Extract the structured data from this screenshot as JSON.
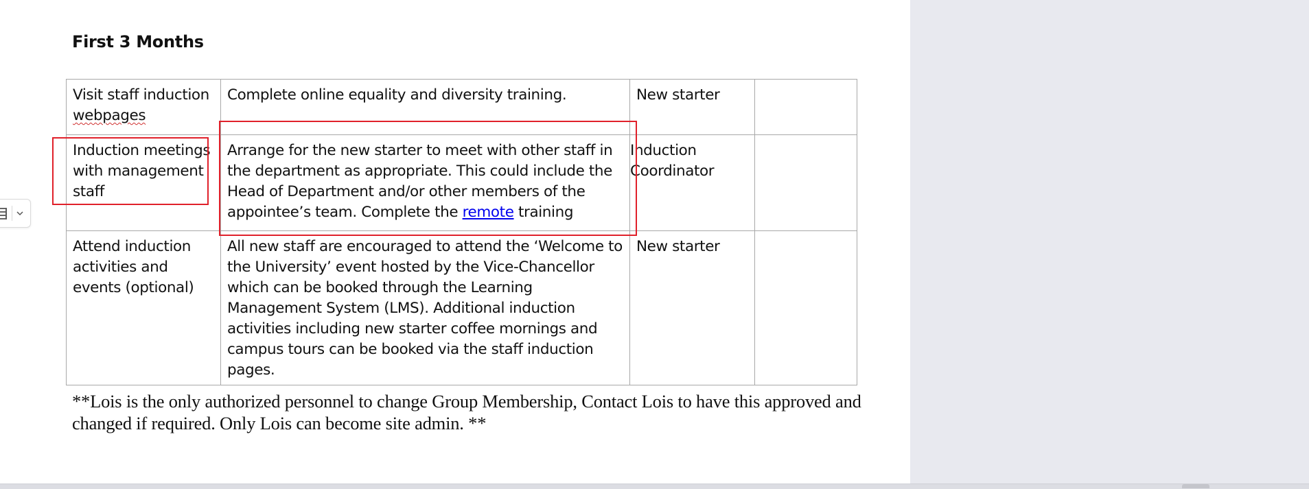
{
  "document": {
    "heading": "First 3 Months",
    "table": {
      "rows": [
        {
          "activity_line1": "Visit staff induction ",
          "activity_spell": "webpages",
          "detail": "Complete online equality and diversity training.",
          "responsible": "New starter",
          "status": ""
        },
        {
          "activity": "Induction meetings with management staff",
          "detail_before_link": "Arrange for the new starter to meet with other staff in the department as appropriate. This could include the Head of Department and/or other members of the appointee’s team. Complete the ",
          "detail_link": "remote",
          "detail_after_link": " training",
          "responsible": "Induction Coordinator",
          "status": ""
        },
        {
          "activity": "Attend induction activities and events (optional)",
          "detail": "All new staff are encouraged to attend the ‘Welcome to the University’ event hosted by the Vice-Chancellor which can be booked through the Learning Management System (LMS). Additional induction activities including new starter coffee mornings and campus tours can be booked via the staff induction pages.",
          "responsible": "New starter",
          "status": ""
        }
      ]
    },
    "note": "**Lois is the only authorized personnel to change Group Membership, Contact Lois to have this approved and changed if required. Only Lois can become site admin. **"
  },
  "toolbar": {
    "icons": [
      "list-format-icon",
      "chevron-down-icon"
    ]
  },
  "colors": {
    "highlight_box": "#e0202a",
    "link": "#0000ee",
    "background": "#e8e9ef"
  }
}
